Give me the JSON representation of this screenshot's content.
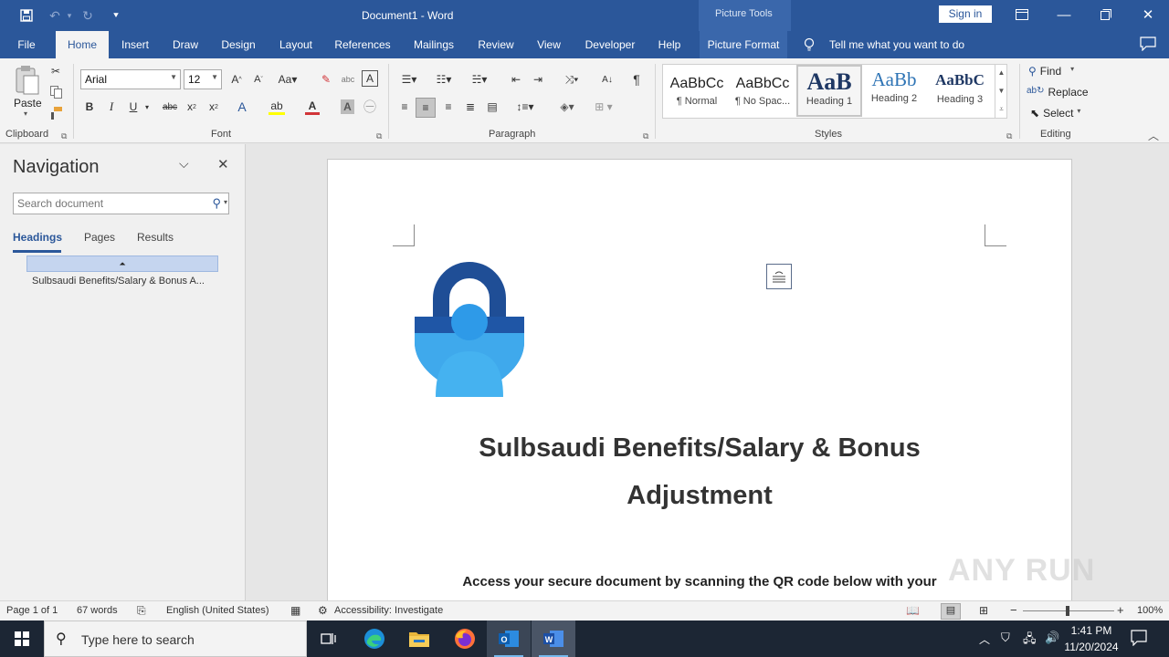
{
  "titlebar": {
    "document_title": "Document1 - Word",
    "context_group": "Picture Tools",
    "sign_in_label": "Sign in"
  },
  "tabs": [
    "File",
    "Home",
    "Insert",
    "Draw",
    "Design",
    "Layout",
    "References",
    "Mailings",
    "Review",
    "View",
    "Developer",
    "Help",
    "Picture Format"
  ],
  "tell_me": "Tell me what you want to do",
  "ribbon": {
    "clipboard": {
      "paste_label": "Paste",
      "group_label": "Clipboard"
    },
    "font": {
      "font_name": "Arial",
      "font_size": "12",
      "group_label": "Font"
    },
    "paragraph": {
      "group_label": "Paragraph"
    },
    "styles": {
      "group_label": "Styles",
      "items": [
        {
          "preview": "AaBbCc",
          "label": "¶ Normal"
        },
        {
          "preview": "AaBbCc",
          "label": "¶ No Spac..."
        },
        {
          "preview": "AaB",
          "label": "Heading 1"
        },
        {
          "preview": "AaBb",
          "label": "Heading 2"
        },
        {
          "preview": "AaBbC",
          "label": "Heading 3"
        }
      ]
    },
    "editing": {
      "find": "Find",
      "replace": "Replace",
      "select": "Select",
      "group_label": "Editing"
    }
  },
  "navigation": {
    "title": "Navigation",
    "search_placeholder": "Search document",
    "tabs": [
      "Headings",
      "Pages",
      "Results"
    ],
    "heading_item": "Sulbsaudi Benefits/Salary & Bonus A..."
  },
  "document": {
    "heading_line1": "Sulbsaudi Benefits/Salary & Bonus",
    "heading_line2": "Adjustment",
    "body_text": "Access your secure document by scanning the QR code below with your"
  },
  "statusbar": {
    "page": "Page 1 of 1",
    "words": "67 words",
    "language": "English (United States)",
    "accessibility": "Accessibility: Investigate",
    "zoom": "100%"
  },
  "watermark": "ANY RUN",
  "taskbar": {
    "search_placeholder": "Type here to search",
    "time": "1:41 PM",
    "date": "11/20/2024"
  }
}
